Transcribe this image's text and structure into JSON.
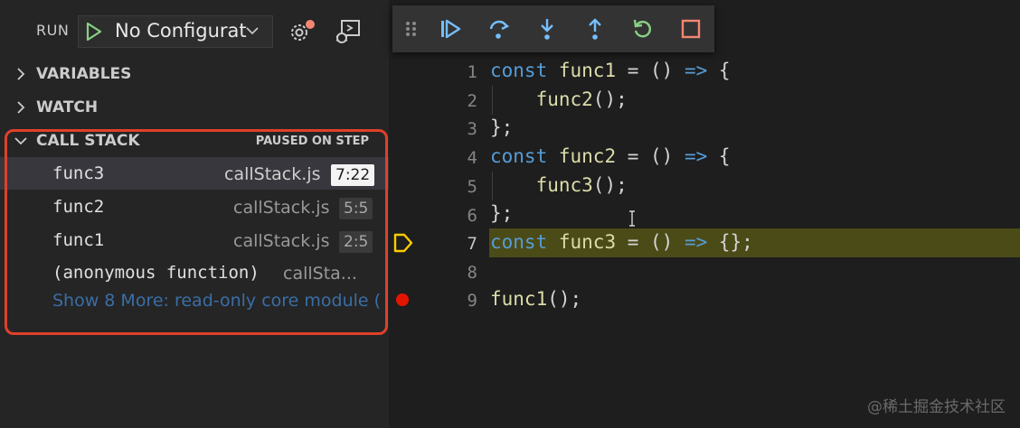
{
  "run_panel": {
    "run_label": "RUN",
    "configuration": "No Configurat"
  },
  "sections": {
    "variables": "VARIABLES",
    "watch": "WATCH",
    "call_stack": "CALL STACK",
    "call_stack_status": "PAUSED ON STEP"
  },
  "call_stack": {
    "frames": [
      {
        "function": "func3",
        "file": "callStack.js",
        "location": "7:22"
      },
      {
        "function": "func2",
        "file": "callStack.js",
        "location": "5:5"
      },
      {
        "function": "func1",
        "file": "callStack.js",
        "location": "2:5"
      },
      {
        "function": "(anonymous function)",
        "file": "callSta..."
      }
    ],
    "show_more": "Show 8 More: read-only core module ("
  },
  "editor": {
    "line_numbers": [
      "1",
      "2",
      "3",
      "4",
      "5",
      "6",
      "7",
      "8",
      "9"
    ],
    "code": {
      "l1_kw": "const",
      "l1_name": "func1",
      "l1_rest": " = () ",
      "l1_arrow": "=>",
      "l1_end": " {",
      "l2_name": "func2",
      "l2_rest": "();",
      "l3": "};",
      "l4_kw": "const",
      "l4_name": "func2",
      "l4_rest": " = () ",
      "l4_arrow": "=>",
      "l4_end": " {",
      "l5_name": "func3",
      "l5_rest": "();",
      "l6": "};",
      "l7_kw": "const",
      "l7_name": "func3",
      "l7_rest": " = () ",
      "l7_arrow": "=>",
      "l7_end": " {};",
      "l9_name": "func1",
      "l9_rest": "();"
    },
    "current_line": 7,
    "breakpoint_line": 9
  },
  "debug_toolbar": [
    "continue-icon",
    "step-over-icon",
    "step-into-icon",
    "step-out-icon",
    "restart-icon",
    "stop-icon"
  ],
  "colors": {
    "highlight_border": "#e0402a",
    "current_line": "#4b4b18",
    "breakpoint": "#e51400",
    "toolbar_blue": "#75beff",
    "restart_green": "#89d185",
    "stop_orange": "#f48771"
  },
  "watermark": "@稀土掘金技术社区"
}
